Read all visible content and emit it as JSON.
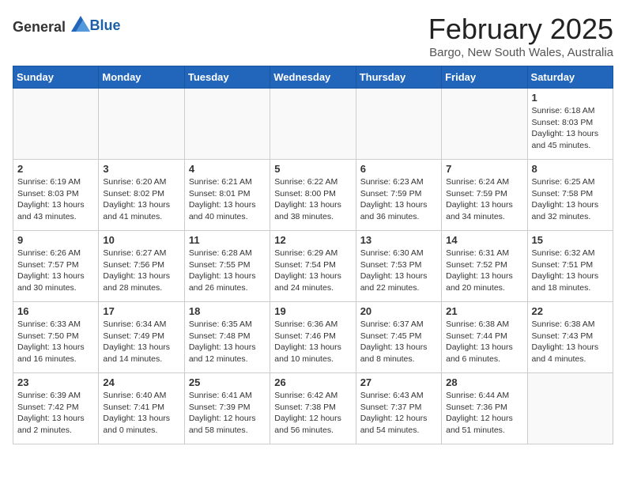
{
  "header": {
    "logo_general": "General",
    "logo_blue": "Blue",
    "month": "February 2025",
    "location": "Bargo, New South Wales, Australia"
  },
  "weekdays": [
    "Sunday",
    "Monday",
    "Tuesday",
    "Wednesday",
    "Thursday",
    "Friday",
    "Saturday"
  ],
  "weeks": [
    [
      {
        "day": "",
        "info": ""
      },
      {
        "day": "",
        "info": ""
      },
      {
        "day": "",
        "info": ""
      },
      {
        "day": "",
        "info": ""
      },
      {
        "day": "",
        "info": ""
      },
      {
        "day": "",
        "info": ""
      },
      {
        "day": "1",
        "info": "Sunrise: 6:18 AM\nSunset: 8:03 PM\nDaylight: 13 hours\nand 45 minutes."
      }
    ],
    [
      {
        "day": "2",
        "info": "Sunrise: 6:19 AM\nSunset: 8:03 PM\nDaylight: 13 hours\nand 43 minutes."
      },
      {
        "day": "3",
        "info": "Sunrise: 6:20 AM\nSunset: 8:02 PM\nDaylight: 13 hours\nand 41 minutes."
      },
      {
        "day": "4",
        "info": "Sunrise: 6:21 AM\nSunset: 8:01 PM\nDaylight: 13 hours\nand 40 minutes."
      },
      {
        "day": "5",
        "info": "Sunrise: 6:22 AM\nSunset: 8:00 PM\nDaylight: 13 hours\nand 38 minutes."
      },
      {
        "day": "6",
        "info": "Sunrise: 6:23 AM\nSunset: 7:59 PM\nDaylight: 13 hours\nand 36 minutes."
      },
      {
        "day": "7",
        "info": "Sunrise: 6:24 AM\nSunset: 7:59 PM\nDaylight: 13 hours\nand 34 minutes."
      },
      {
        "day": "8",
        "info": "Sunrise: 6:25 AM\nSunset: 7:58 PM\nDaylight: 13 hours\nand 32 minutes."
      }
    ],
    [
      {
        "day": "9",
        "info": "Sunrise: 6:26 AM\nSunset: 7:57 PM\nDaylight: 13 hours\nand 30 minutes."
      },
      {
        "day": "10",
        "info": "Sunrise: 6:27 AM\nSunset: 7:56 PM\nDaylight: 13 hours\nand 28 minutes."
      },
      {
        "day": "11",
        "info": "Sunrise: 6:28 AM\nSunset: 7:55 PM\nDaylight: 13 hours\nand 26 minutes."
      },
      {
        "day": "12",
        "info": "Sunrise: 6:29 AM\nSunset: 7:54 PM\nDaylight: 13 hours\nand 24 minutes."
      },
      {
        "day": "13",
        "info": "Sunrise: 6:30 AM\nSunset: 7:53 PM\nDaylight: 13 hours\nand 22 minutes."
      },
      {
        "day": "14",
        "info": "Sunrise: 6:31 AM\nSunset: 7:52 PM\nDaylight: 13 hours\nand 20 minutes."
      },
      {
        "day": "15",
        "info": "Sunrise: 6:32 AM\nSunset: 7:51 PM\nDaylight: 13 hours\nand 18 minutes."
      }
    ],
    [
      {
        "day": "16",
        "info": "Sunrise: 6:33 AM\nSunset: 7:50 PM\nDaylight: 13 hours\nand 16 minutes."
      },
      {
        "day": "17",
        "info": "Sunrise: 6:34 AM\nSunset: 7:49 PM\nDaylight: 13 hours\nand 14 minutes."
      },
      {
        "day": "18",
        "info": "Sunrise: 6:35 AM\nSunset: 7:48 PM\nDaylight: 13 hours\nand 12 minutes."
      },
      {
        "day": "19",
        "info": "Sunrise: 6:36 AM\nSunset: 7:46 PM\nDaylight: 13 hours\nand 10 minutes."
      },
      {
        "day": "20",
        "info": "Sunrise: 6:37 AM\nSunset: 7:45 PM\nDaylight: 13 hours\nand 8 minutes."
      },
      {
        "day": "21",
        "info": "Sunrise: 6:38 AM\nSunset: 7:44 PM\nDaylight: 13 hours\nand 6 minutes."
      },
      {
        "day": "22",
        "info": "Sunrise: 6:38 AM\nSunset: 7:43 PM\nDaylight: 13 hours\nand 4 minutes."
      }
    ],
    [
      {
        "day": "23",
        "info": "Sunrise: 6:39 AM\nSunset: 7:42 PM\nDaylight: 13 hours\nand 2 minutes."
      },
      {
        "day": "24",
        "info": "Sunrise: 6:40 AM\nSunset: 7:41 PM\nDaylight: 13 hours\nand 0 minutes."
      },
      {
        "day": "25",
        "info": "Sunrise: 6:41 AM\nSunset: 7:39 PM\nDaylight: 12 hours\nand 58 minutes."
      },
      {
        "day": "26",
        "info": "Sunrise: 6:42 AM\nSunset: 7:38 PM\nDaylight: 12 hours\nand 56 minutes."
      },
      {
        "day": "27",
        "info": "Sunrise: 6:43 AM\nSunset: 7:37 PM\nDaylight: 12 hours\nand 54 minutes."
      },
      {
        "day": "28",
        "info": "Sunrise: 6:44 AM\nSunset: 7:36 PM\nDaylight: 12 hours\nand 51 minutes."
      },
      {
        "day": "",
        "info": ""
      }
    ]
  ]
}
